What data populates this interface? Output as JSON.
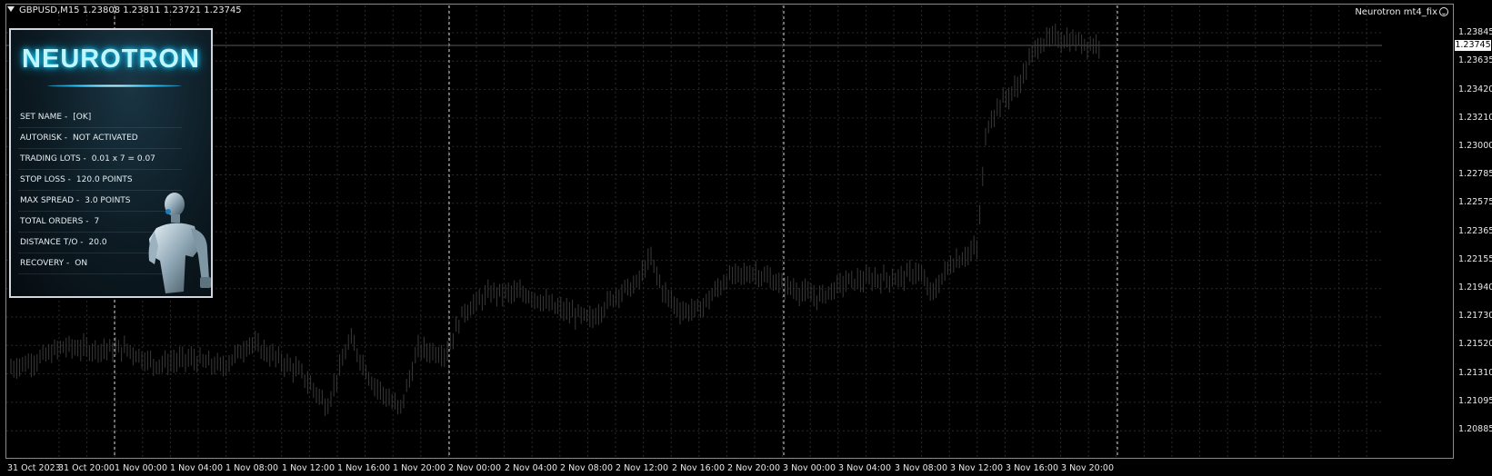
{
  "header": {
    "symbol_line": "GBPUSD,M15  1.23808 1.23811 1.23721 1.23745",
    "ea_name": "Neurotron mt4_fix"
  },
  "price_axis": {
    "labels": [
      "1.23845",
      "1.23635",
      "1.23420",
      "1.23210",
      "1.23000",
      "1.22785",
      "1.22575",
      "1.22365",
      "1.22155",
      "1.21940",
      "1.21730",
      "1.21520",
      "1.21310",
      "1.21095",
      "1.20885"
    ],
    "current_price": "1.23745"
  },
  "time_axis": {
    "labels": [
      "31 Oct 2023",
      "31 Oct 20:00",
      "1 Nov 00:00",
      "1 Nov 04:00",
      "1 Nov 08:00",
      "1 Nov 12:00",
      "1 Nov 16:00",
      "1 Nov 20:00",
      "2 Nov 00:00",
      "2 Nov 04:00",
      "2 Nov 08:00",
      "2 Nov 12:00",
      "2 Nov 16:00",
      "2 Nov 20:00",
      "3 Nov 00:00",
      "3 Nov 04:00",
      "3 Nov 08:00",
      "3 Nov 12:00",
      "3 Nov 16:00",
      "3 Nov 20:00"
    ]
  },
  "panel": {
    "title": "NEUROTRON",
    "rows": [
      {
        "label": "SET NAME -",
        "value": "[OK]"
      },
      {
        "label": "AUTORISK -",
        "value": "NOT ACTIVATED"
      },
      {
        "label": "TRADING LOTS -",
        "value": "0.01 x 7 = 0.07"
      },
      {
        "label": "STOP LOSS -",
        "value": "120.0 POINTS"
      },
      {
        "label": "MAX SPREAD -",
        "value": "3.0 POINTS"
      },
      {
        "label": "TOTAL ORDERS -",
        "value": "7"
      },
      {
        "label": "DISTANCE T/O -",
        "value": "20.0"
      },
      {
        "label": "RECOVERY -",
        "value": "ON"
      }
    ]
  },
  "colors": {
    "background": "#000000",
    "grid": "#2a2a2a",
    "candles": "#3a3a3a",
    "accent": "#30c8ff"
  },
  "icons": {
    "header_arrow": "triangle-down-icon",
    "smiley": "smiley-icon",
    "robot": "robot-figure-icon"
  }
}
